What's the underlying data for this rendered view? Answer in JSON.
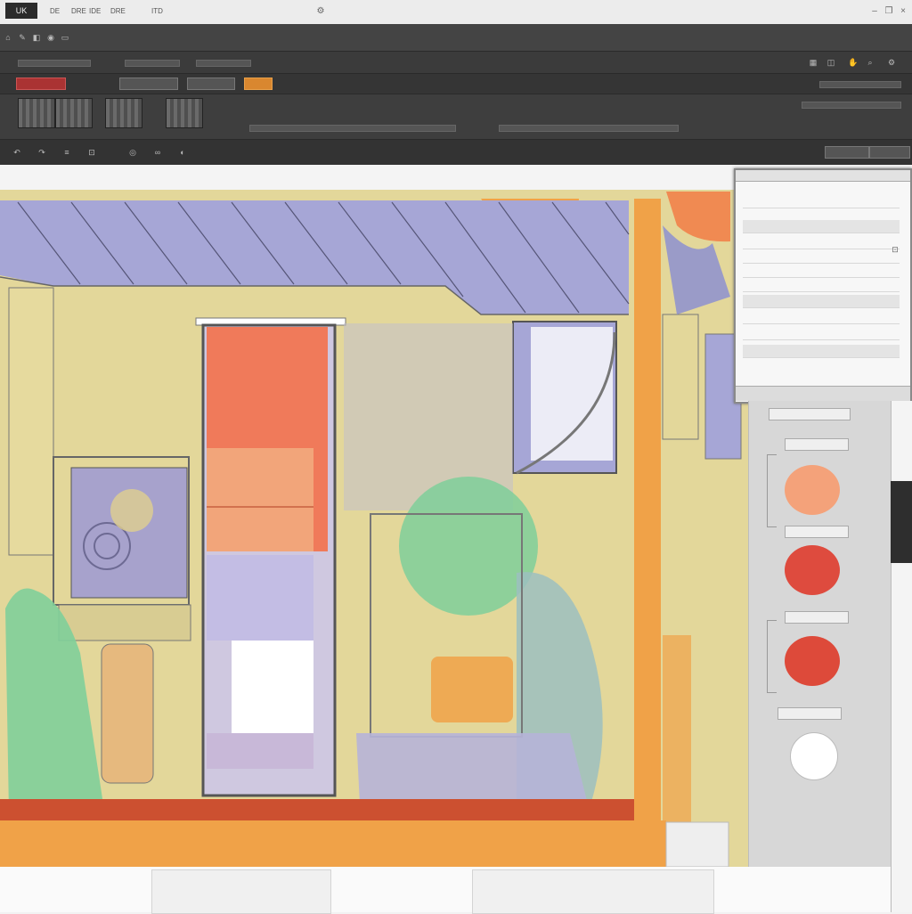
{
  "titlebar": {
    "app_badge": "UK",
    "menus": [
      "DE",
      "DRE",
      "IDE",
      "DRE",
      "ITD"
    ],
    "doc_title": "",
    "right_icons": [
      "minimize-icon",
      "restore-icon",
      "close-icon"
    ]
  },
  "toolbar": {
    "row1_label": "",
    "row1_right": [
      "",
      "",
      "",
      "",
      ""
    ],
    "row3_chips": [
      "",
      "",
      ""
    ],
    "row4_thumbs": 4,
    "row5_label": ""
  },
  "layers_panel": {
    "title": "",
    "rows": [
      "",
      "",
      "",
      "",
      "",
      "",
      "",
      "",
      "",
      ""
    ],
    "footer": ""
  },
  "swatches": {
    "colors": [
      "#f4a27a",
      "#de4b3e",
      "#dd4a3a",
      "#ffffff"
    ],
    "labels": [
      "",
      "",
      "",
      ""
    ]
  },
  "colors": {
    "accent_orange": "#f0a248",
    "roof_purple": "#a6a6d6",
    "wall_yellow": "#e3d79a",
    "door_red": "#f07a5a",
    "bush_green": "#7fcf9a",
    "floor_red": "#cc5030"
  }
}
